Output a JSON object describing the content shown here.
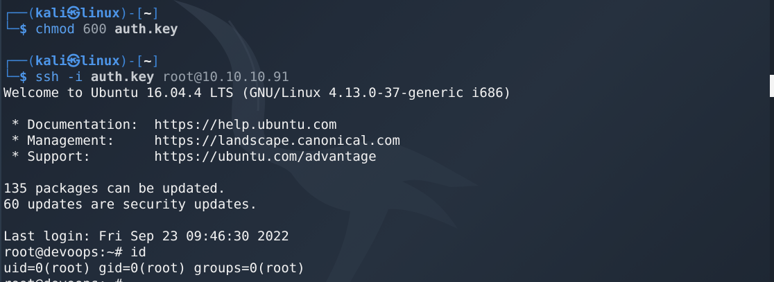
{
  "session1": {
    "frame_top": "┌──",
    "open_paren": "(",
    "user": "kali",
    "at": "㉿",
    "host": "linux",
    "close_dash": ")-[",
    "dir": "~",
    "close_bracket": "]",
    "frame_bottom": "└─",
    "dollar": "$",
    "cmd": "chmod",
    "arg": "600",
    "file": "auth.key"
  },
  "session2": {
    "frame_top": "┌──",
    "open_paren": "(",
    "user": "kali",
    "at": "㉿",
    "host": "linux",
    "close_dash": ")-[",
    "dir": "~",
    "close_bracket": "]",
    "frame_bottom": "└─",
    "dollar": "$",
    "cmd": "ssh",
    "flag": "-i",
    "file": "auth.key",
    "target": "root@10.10.10.91"
  },
  "output": {
    "welcome": "Welcome to Ubuntu 16.04.4 LTS (GNU/Linux 4.13.0-37-generic i686)",
    "doc": " * Documentation:  https://help.ubuntu.com",
    "mgmt": " * Management:     https://landscape.canonical.com",
    "support": " * Support:        https://ubuntu.com/advantage",
    "packages": "135 packages can be updated.",
    "security": "60 updates are security updates.",
    "last_login": "Last login: Fri Sep 23 09:46:30 2022",
    "prompt_id": "root@devoops:~# id",
    "uid": "uid=0(root) gid=0(root) groups=0(root)",
    "prompt_next": "root@devoops:~#"
  },
  "colors": {
    "background": "#222c3a",
    "prompt_blue": "#4d95e8",
    "text": "#f2f2f2"
  }
}
